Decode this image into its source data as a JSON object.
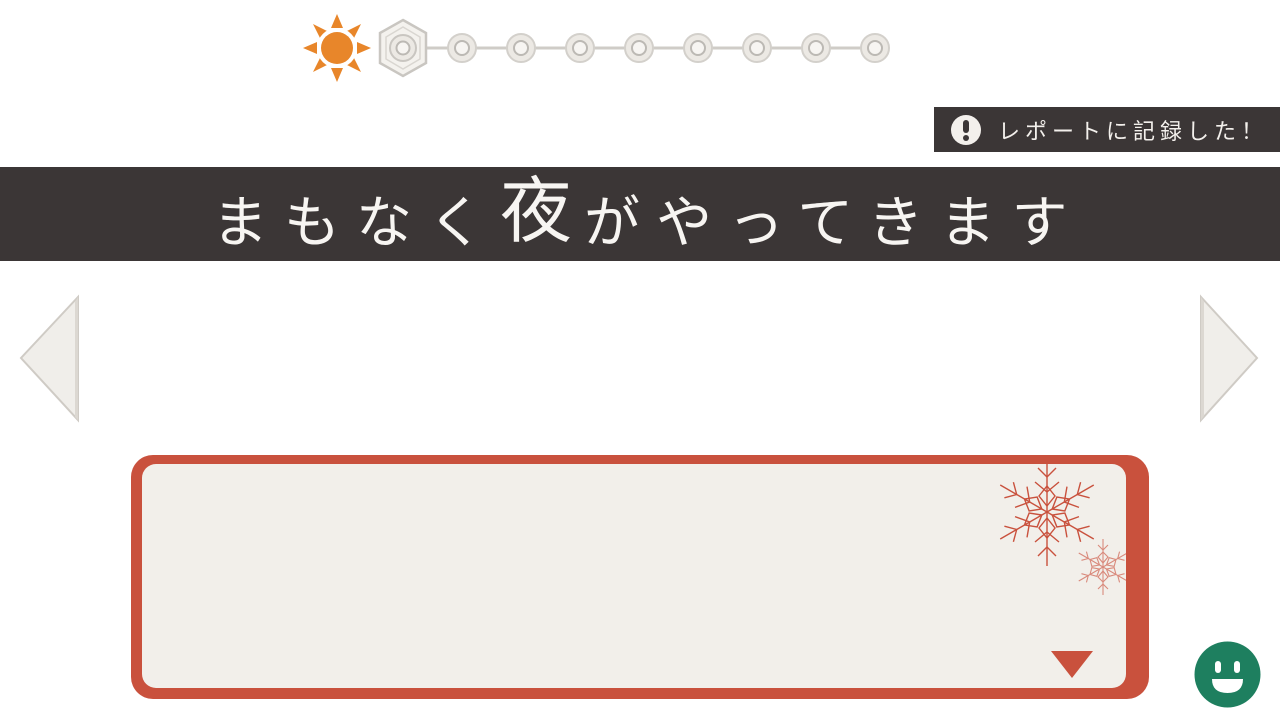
{
  "time_track": {
    "start_icon": "sun-icon",
    "end_icon": "moon-icon",
    "node_count": 9,
    "current_node": 1,
    "colors": {
      "sun": "#e8862a",
      "moon": "#f6c12b",
      "node": "#ece9e4",
      "node_outline": "#c9c6c1"
    }
  },
  "report_notice": {
    "icon": "exclamation-icon",
    "text": "レポートに記録した！"
  },
  "banner": {
    "text_before": "まもなく",
    "text_emphasis": "夜",
    "text_after": "がやってきます"
  },
  "navigation": {
    "prev_icon": "left-arrow-icon",
    "next_icon": "right-arrow-icon"
  },
  "dialog": {
    "text": "",
    "decoration_icon": "snowflake-icon",
    "advance_icon": "advance-triangle-icon",
    "colors": {
      "frame": "#c9513d",
      "panel": "#f2efea"
    }
  },
  "menu_button": {
    "icon": "smiley-face-icon",
    "color": "#1e7f5f"
  }
}
